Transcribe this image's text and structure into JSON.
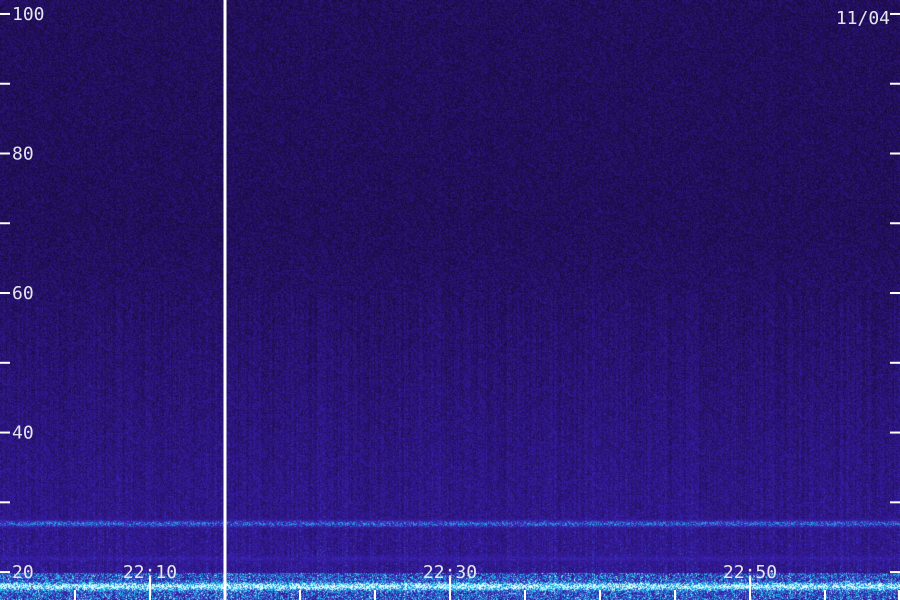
{
  "date_label": "11/04",
  "chart_data": {
    "type": "heatmap",
    "title": "",
    "xlabel": "",
    "ylabel": "",
    "ylim": [
      16,
      102
    ],
    "yticks_labeled": [
      100,
      80,
      60,
      40,
      20
    ],
    "yticks_minor": [
      90,
      70,
      50,
      30
    ],
    "x_tick_labels": [
      "22:10",
      "22:30",
      "22:50"
    ],
    "x_minor_ticks": [
      "22:05",
      "22:15",
      "22:20",
      "22:25",
      "22:35",
      "22:40",
      "22:45",
      "22:55",
      "23:00"
    ],
    "x_range": [
      "22:00",
      "23:00"
    ],
    "data_gap_time": "22:15",
    "bands": [
      {
        "center": 27,
        "intensity": 0.75
      },
      {
        "center": 22,
        "intensity": 0.5
      },
      {
        "center": 18,
        "intensity": 0.95
      }
    ],
    "colors": {
      "low": "#1a0a40",
      "mid": "#3a1fb0",
      "high": "#20c8f0",
      "peak": "#e0ffff"
    }
  }
}
